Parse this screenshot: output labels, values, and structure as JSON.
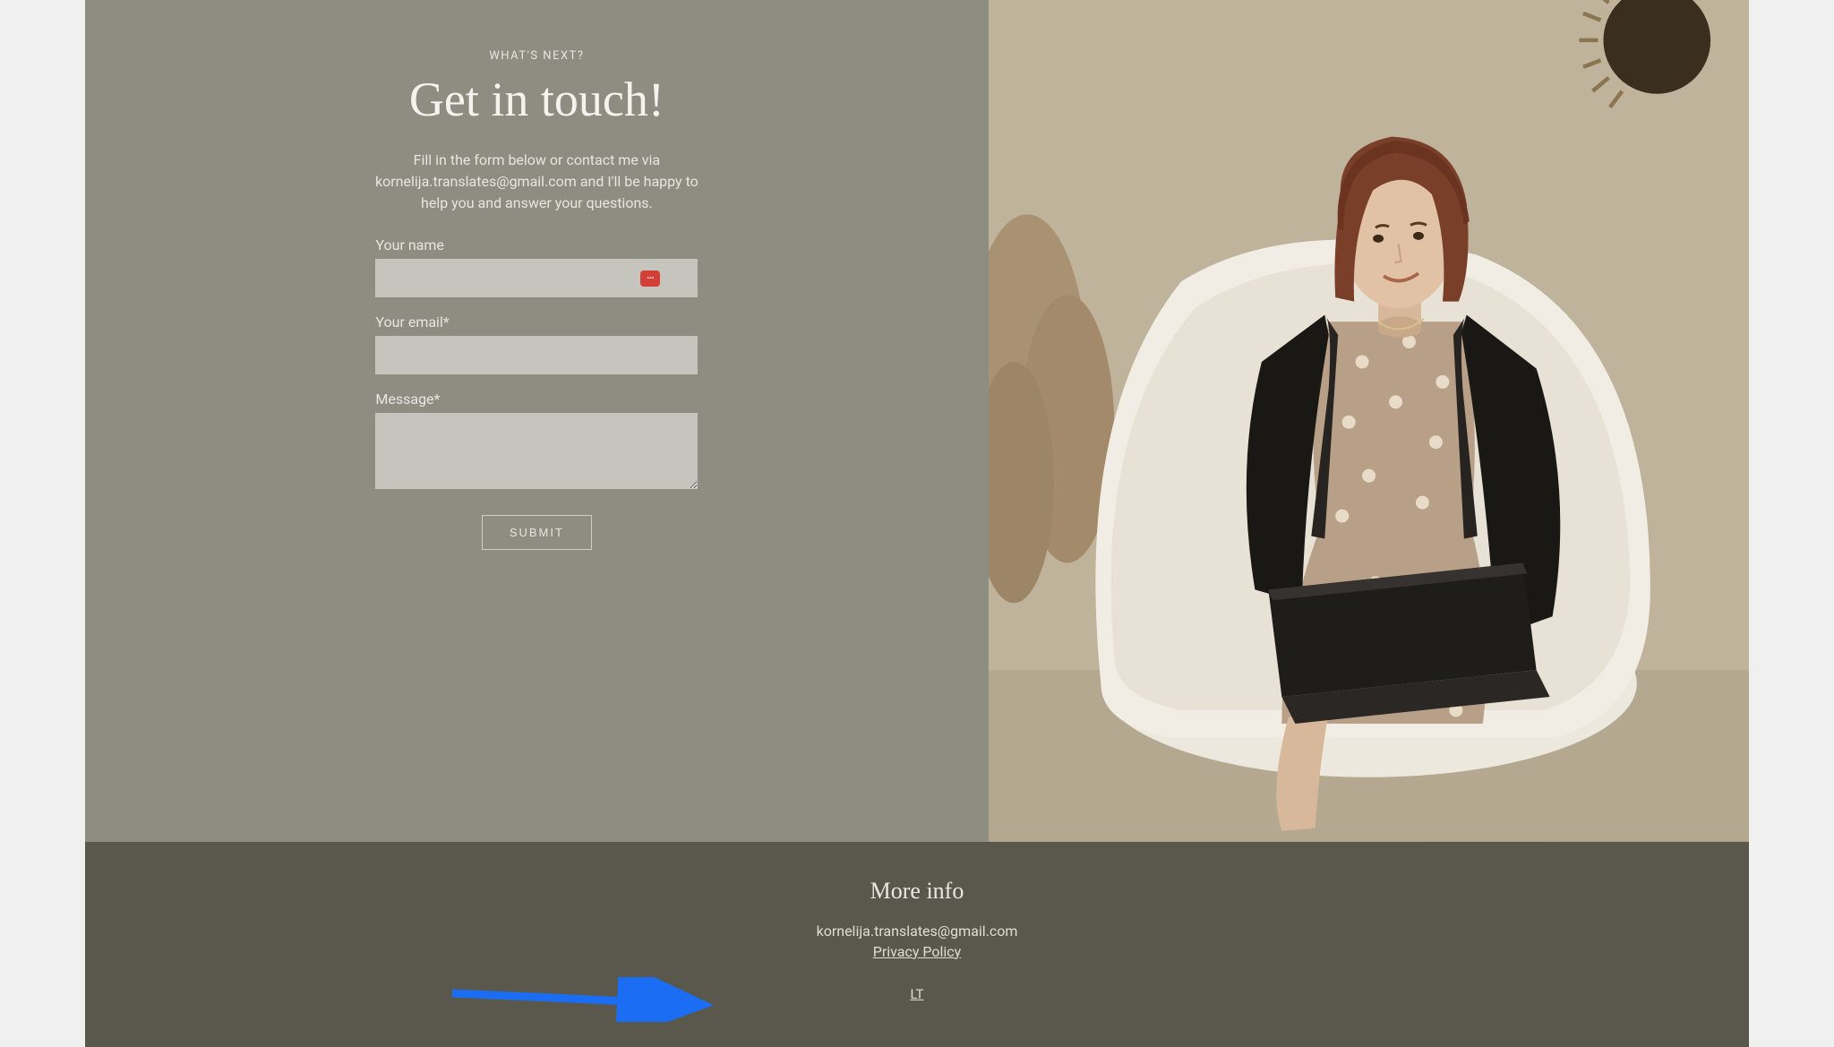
{
  "hero": {
    "eyebrow": "WHAT'S NEXT?",
    "heading": "Get in touch!",
    "intro": "Fill in the form below or contact me via kornelija.translates@gmail.com and I'll be happy to help you and answer your questions."
  },
  "form": {
    "name_label": "Your name",
    "name_value": "",
    "email_label": "Your email*",
    "email_value": "",
    "message_label": "Message*",
    "message_value": "",
    "submit_label": "SUBMIT"
  },
  "footer": {
    "heading": "More info",
    "email": "kornelija.translates@gmail.com",
    "privacy_label": "Privacy Policy",
    "lang_label": "LT"
  },
  "icons": {
    "password_manager": "password-manager-icon"
  }
}
